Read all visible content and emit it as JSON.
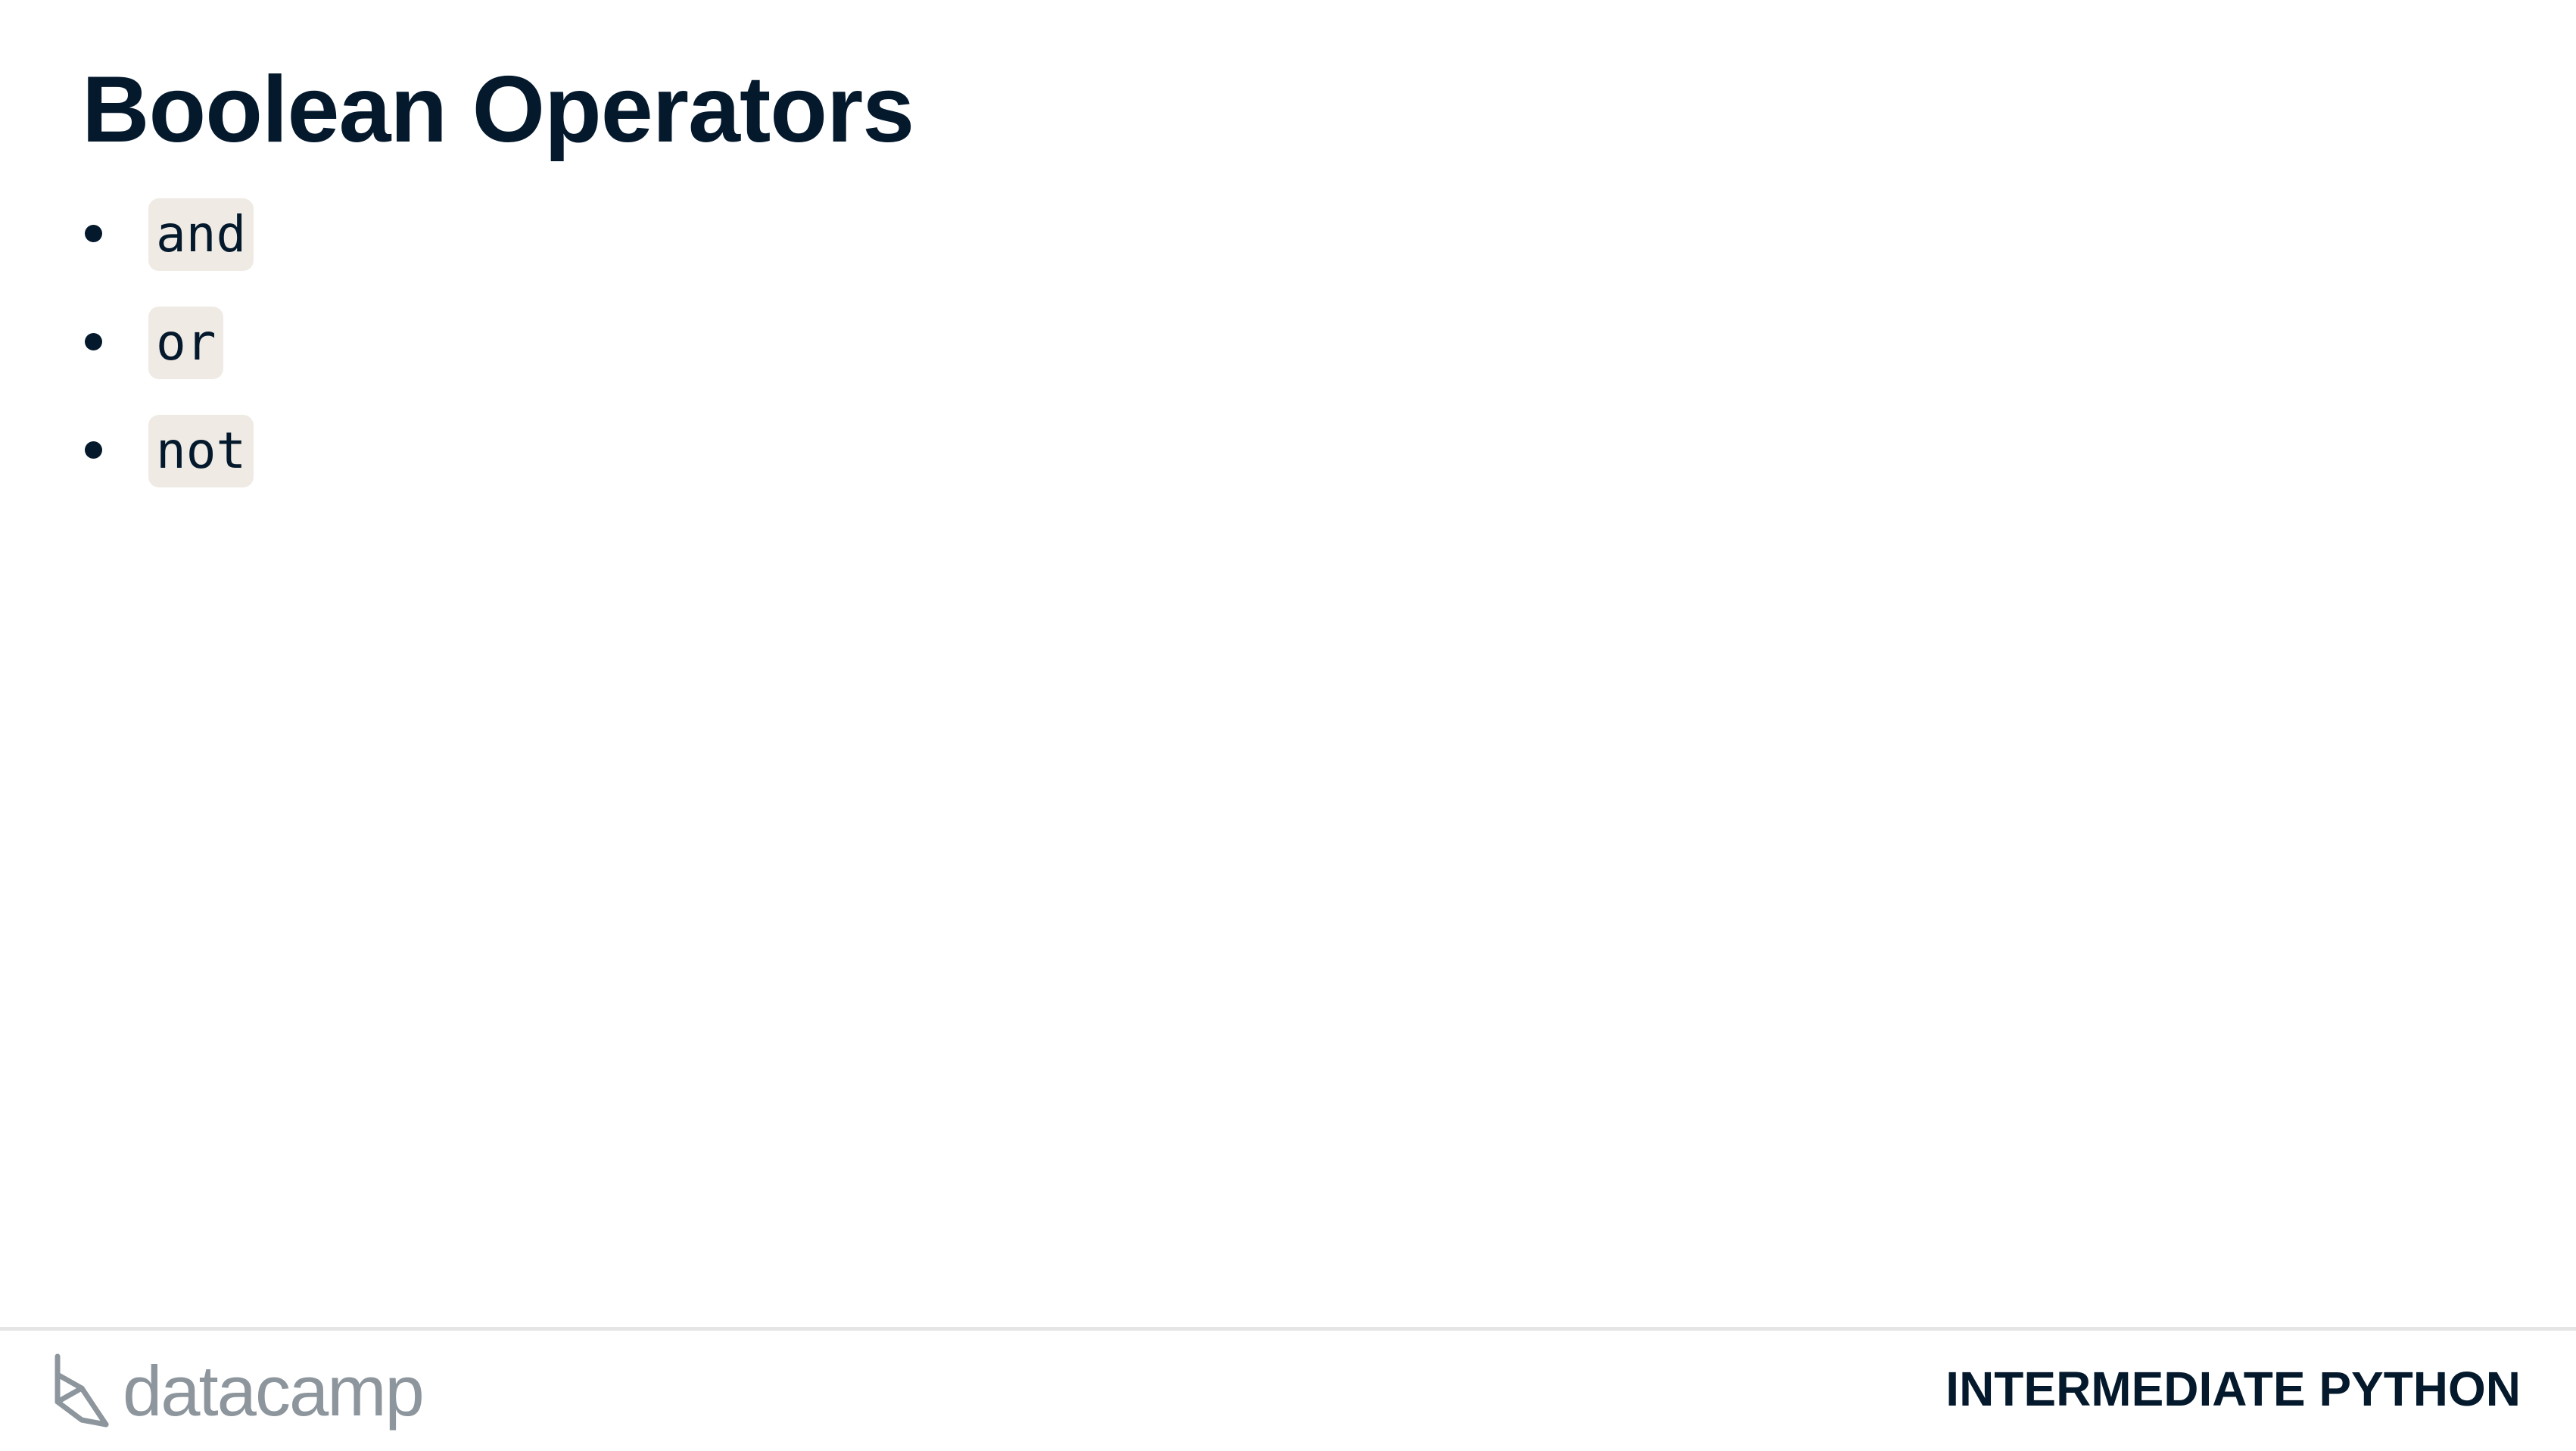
{
  "slide": {
    "title": "Boolean Operators",
    "bullets": [
      {
        "code": "and"
      },
      {
        "code": "or"
      },
      {
        "code": "not"
      }
    ]
  },
  "footer": {
    "logo_text": "datacamp",
    "logo_icon": "datacamp-logo-icon",
    "course_name": "INTERMEDIATE PYTHON"
  },
  "colors": {
    "text": "#05192d",
    "code_background": "#efebe4",
    "logo": "#8e969d",
    "divider": "#e5e5e5"
  }
}
